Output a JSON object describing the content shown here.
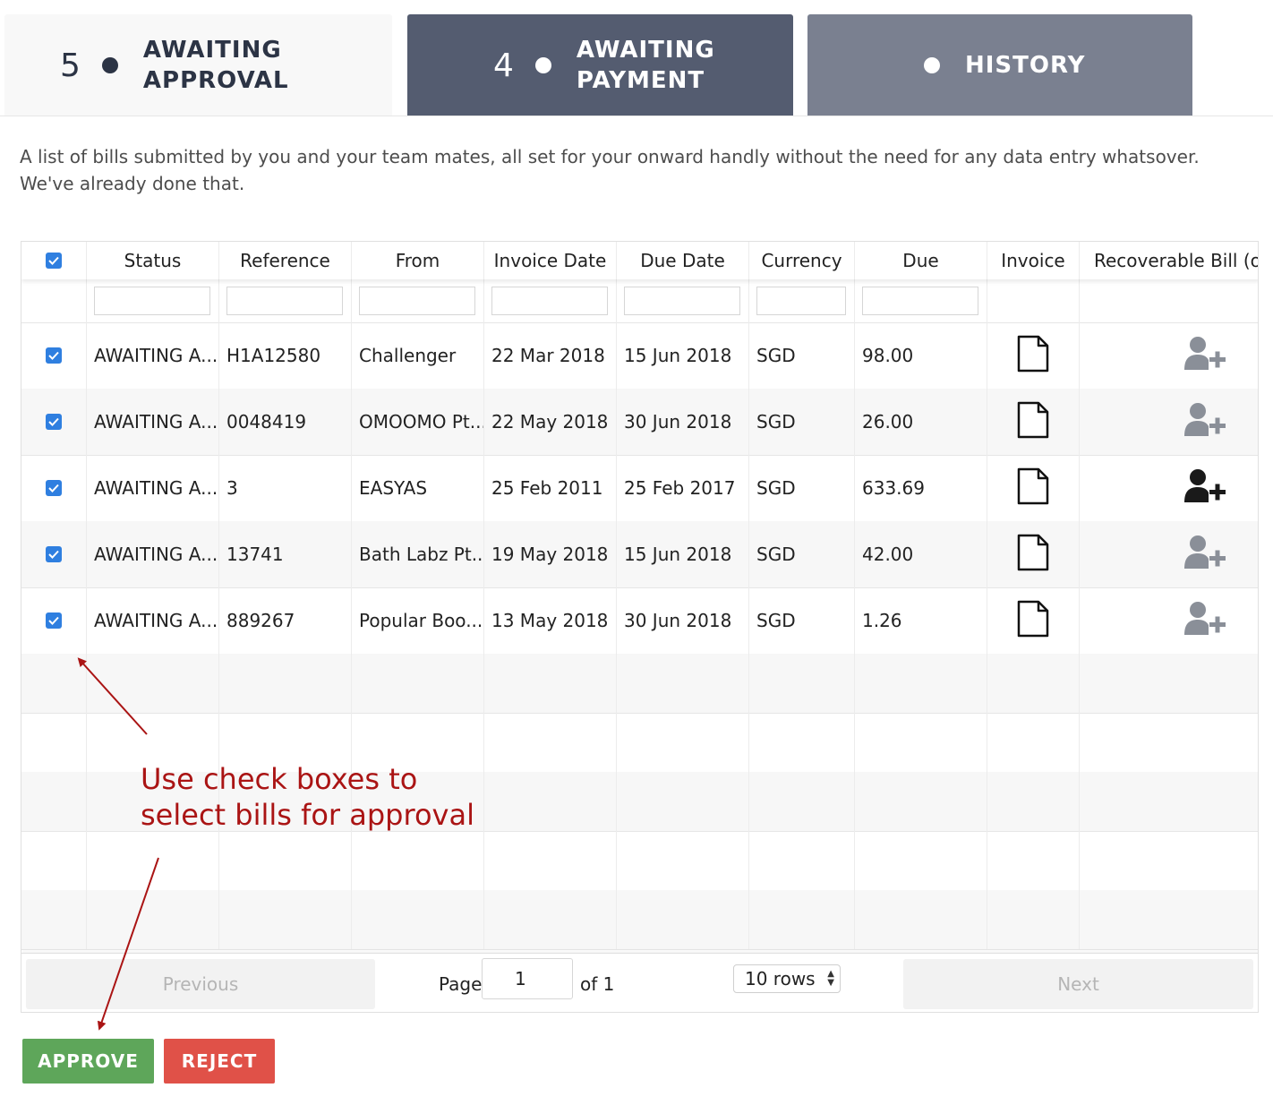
{
  "tabs": [
    {
      "count": "5",
      "label": "AWAITING APPROVAL"
    },
    {
      "count": "4",
      "label": "AWAITING PAYMENT"
    },
    {
      "count": "",
      "label": "HISTORY"
    }
  ],
  "description": "A list of bills submitted by you and your team mates, all set for your onward handly without the need for any data entry whatsover. We've already done that.",
  "table": {
    "columns": [
      "Status",
      "Reference",
      "From",
      "Invoice Date",
      "Due Date",
      "Currency",
      "Due",
      "Invoice",
      "Recoverable Bill (op"
    ],
    "rows": [
      {
        "status": "AWAITING A...",
        "reference": "H1A12580",
        "from": "Challenger",
        "invoice_date": "22 Mar 2018",
        "due_date": "15 Jun 2018",
        "currency": "SGD",
        "due": "98.00",
        "recoverable_active": false
      },
      {
        "status": "AWAITING A...",
        "reference": "0048419",
        "from": "OMOOMO Pt...",
        "invoice_date": "22 May 2018",
        "due_date": "30 Jun 2018",
        "currency": "SGD",
        "due": "26.00",
        "recoverable_active": false
      },
      {
        "status": "AWAITING A...",
        "reference": "3",
        "from": "EASYAS",
        "invoice_date": "25 Feb 2011",
        "due_date": "25 Feb 2017",
        "currency": "SGD",
        "due": "633.69",
        "recoverable_active": true
      },
      {
        "status": "AWAITING A...",
        "reference": "13741",
        "from": "Bath Labz Pt...",
        "invoice_date": "19 May 2018",
        "due_date": "15 Jun 2018",
        "currency": "SGD",
        "due": "42.00",
        "recoverable_active": false
      },
      {
        "status": "AWAITING A...",
        "reference": "889267",
        "from": "Popular Boo...",
        "invoice_date": "13 May 2018",
        "due_date": "30 Jun 2018",
        "currency": "SGD",
        "due": "1.26",
        "recoverable_active": false
      }
    ]
  },
  "pagination": {
    "previous_label": "Previous",
    "page_label": "Page",
    "page_value": "1",
    "of_label": "of 1",
    "rows_option": "10 rows",
    "next_label": "Next"
  },
  "actions": {
    "approve_label": "APPROVE",
    "reject_label": "REJECT"
  },
  "annotation": {
    "line1": "Use check boxes to",
    "line2": "select bills for approval"
  },
  "icons": {
    "checkbox": "checkbox-checked-icon",
    "invoice": "document-icon",
    "recoverable": "user-plus-icon"
  },
  "colors": {
    "checkbox": "#2f7fe0",
    "approve": "#5ea65a",
    "reject": "#e05148",
    "annotation": "#aa1414",
    "icon_inactive": "#8a8f98",
    "icon_active": "#1a1a1a"
  }
}
